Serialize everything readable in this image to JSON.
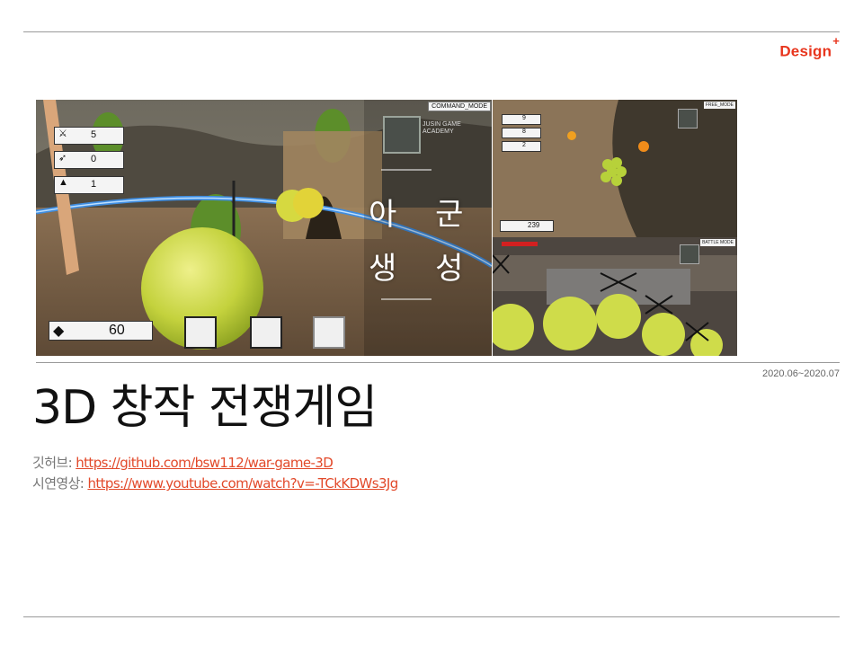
{
  "header": {
    "brand": "Design",
    "brand_plus": "+"
  },
  "screenshots": {
    "main": {
      "hud_stats": [
        "5",
        "0",
        "1"
      ],
      "gem_count": "60",
      "command_label": "COMMAND_MODE",
      "academy_label": "JUSIN GAME ACADEMY",
      "overlay_line1": "아 군",
      "overlay_line2": "생 성"
    },
    "top_right": {
      "hud_stats": [
        "9",
        "8",
        "2"
      ],
      "gem_count": "239",
      "mode_label": "FREE_MODE"
    },
    "bottom_right": {
      "mode_label": "BATTLE MODE"
    }
  },
  "period": "2020.06~2020.07",
  "title": "3D 창작 전쟁게임",
  "links": [
    {
      "label": "깃허브: ",
      "url": "https://github.com/bsw112/war-game-3D"
    },
    {
      "label": "시연영상: ",
      "url": "https://www.youtube.com/watch?v=-TCkKDWs3Jg"
    }
  ],
  "colors": {
    "accent": "#e8361e",
    "link": "#e2492a"
  },
  "icons": [
    "sword-icon",
    "bow-icon",
    "wizard-hat-icon",
    "gem-icon",
    "academy-logo-icon"
  ]
}
